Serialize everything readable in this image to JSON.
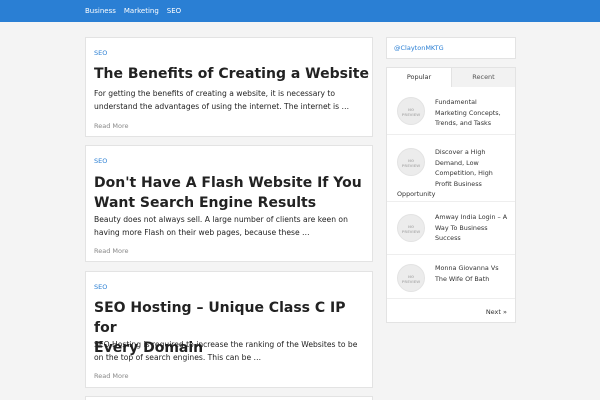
{
  "nav": {
    "items": [
      "Business",
      "Marketing",
      "SEO"
    ]
  },
  "posts": [
    {
      "category": "SEO",
      "title_lines": [
        "The Benefits of Creating a Website"
      ],
      "excerpt_lines": [
        "For getting the benefits of creating a website, it is necessary to",
        "understand the advantages of using the internet. The internet is …"
      ],
      "read_more": "Read More"
    },
    {
      "category": "SEO",
      "title_lines": [
        "Don't Have A Flash Website If You",
        "Want Search Engine Results"
      ],
      "excerpt_lines": [
        "Beauty does not always sell. A large number of clients are keen on",
        "having more Flash on their web pages, because these …"
      ],
      "read_more": "Read More"
    },
    {
      "category": "SEO",
      "title_lines": [
        "SEO Hosting – Unique Class C IP for",
        "Every Domain"
      ],
      "excerpt_lines": [
        "SEO Hosting is required to increase the ranking of the Websites to be",
        "on the top of search engines. This can be …"
      ],
      "read_more": "Read More"
    }
  ],
  "sidebar": {
    "handle": "@ClaytonMKTG",
    "tabs": [
      "Popular",
      "Recent"
    ],
    "placeholder_line1": "NO",
    "placeholder_line2": "PREVIEW",
    "items": [
      {
        "lines": [
          "Fundamental",
          "Marketing Concepts,",
          "Trends, and Tasks"
        ]
      },
      {
        "lines": [
          "Discover a High",
          "Demand, Low",
          "Competition, High",
          "Profit Business"
        ],
        "tail": "Opportunity"
      },
      {
        "lines": [
          "Amway India Login – A",
          "Way To Business",
          "Success"
        ]
      },
      {
        "lines": [
          "Monna Giovanna Vs",
          "The Wife Of Bath"
        ]
      }
    ],
    "next": "Next »"
  }
}
